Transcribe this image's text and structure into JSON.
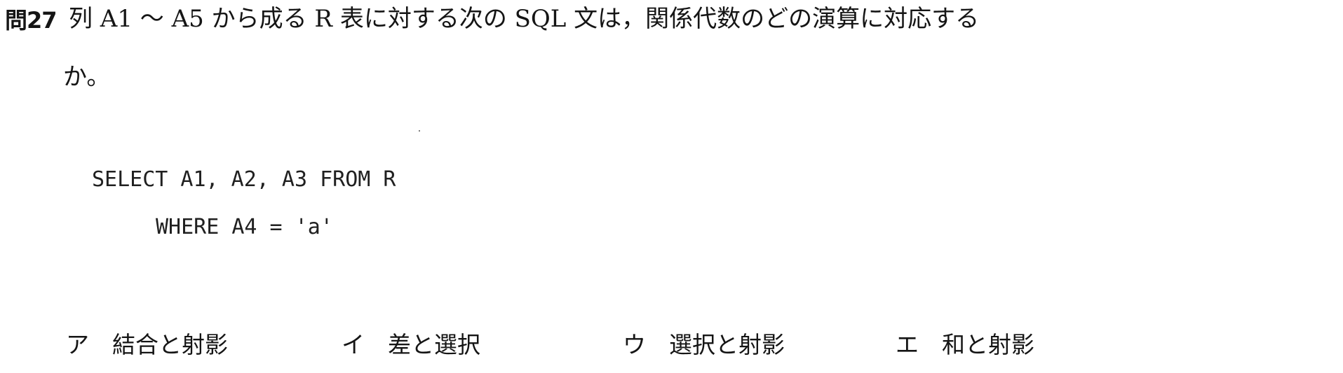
{
  "question": {
    "number": "問27",
    "line1": "列 A1 ～ A5 から成る R 表に対する次の SQL 文は，関係代数のどの演算に対応する",
    "line2": "か。"
  },
  "sql": {
    "line1": "SELECT A1, A2, A3 FROM R",
    "line2": "WHERE A4 = 'a'"
  },
  "choices": [
    {
      "label": "ア",
      "text": "結合と射影"
    },
    {
      "label": "イ",
      "text": "差と選択"
    },
    {
      "label": "ウ",
      "text": "選択と射影"
    },
    {
      "label": "エ",
      "text": "和と射影"
    }
  ]
}
